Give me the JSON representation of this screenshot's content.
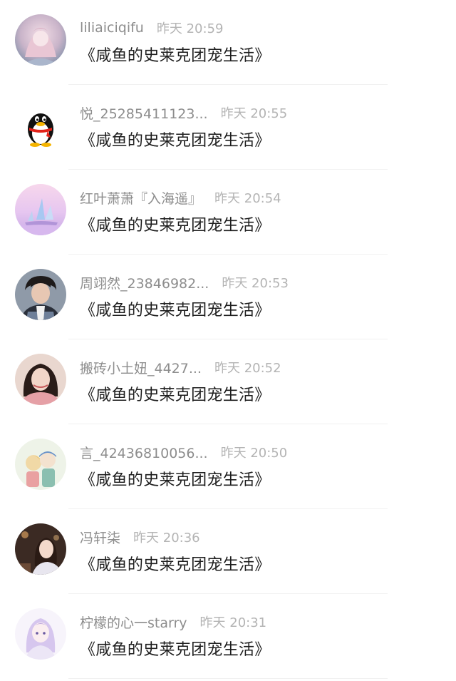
{
  "comments": [
    {
      "username": "liliaiciqifu",
      "time": "昨天 20:59",
      "message": "《咸鱼的史莱克团宠生活》",
      "avatar": "anime-girl-avatar"
    },
    {
      "username": "悦_25285411123...",
      "time": "昨天 20:55",
      "message": "《咸鱼的史莱克团宠生活》",
      "avatar": "penguin-avatar"
    },
    {
      "username": "红叶萧萧『入海遥』",
      "time": "昨天 20:54",
      "message": "《咸鱼的史莱克团宠生活》",
      "avatar": "pink-sailboat-avatar"
    },
    {
      "username": "周翊然_23846982...",
      "time": "昨天 20:53",
      "message": "《咸鱼的史莱克团宠生活》",
      "avatar": "boy-photo-avatar"
    },
    {
      "username": "搬砖小土妞_4427...",
      "time": "昨天 20:52",
      "message": "《咸鱼的史莱克团宠生活》",
      "avatar": "girl-photo-avatar"
    },
    {
      "username": "言_42436810056...",
      "time": "昨天 20:50",
      "message": "《咸鱼的史莱克团宠生活》",
      "avatar": "cartoon-duo-avatar"
    },
    {
      "username": "冯轩柒",
      "time": "昨天 20:36",
      "message": "《咸鱼的史莱克团宠生活》",
      "avatar": "night-girl-avatar"
    },
    {
      "username": "柠檬的心一starry",
      "time": "昨天 20:31",
      "message": "《咸鱼的史莱克团宠生活》",
      "avatar": "anime-sketch-avatar"
    }
  ]
}
